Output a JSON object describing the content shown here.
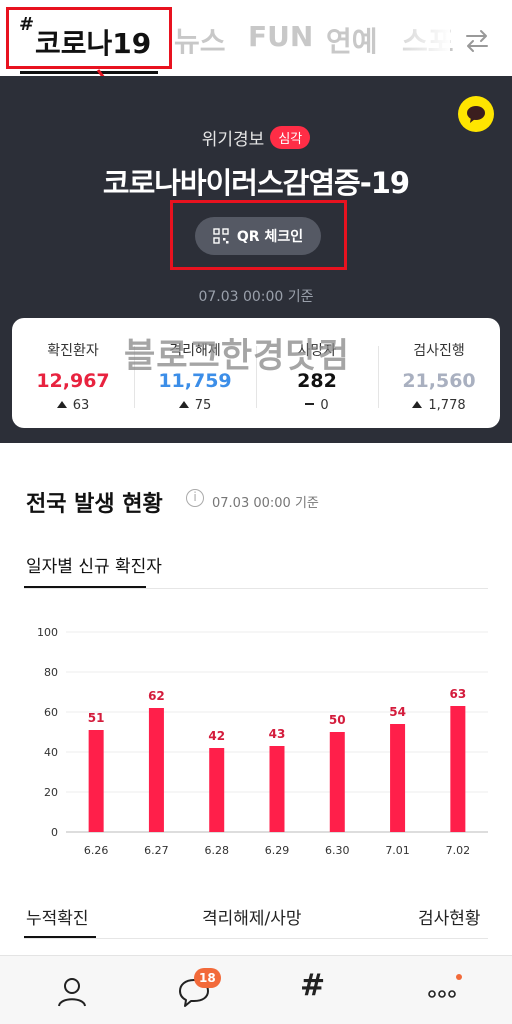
{
  "tabs": {
    "active": {
      "hash": "#",
      "label": "코로나19"
    },
    "items": [
      "뉴스",
      "FUN",
      "연예",
      "스포"
    ]
  },
  "hero": {
    "warning_label": "위기경보",
    "warning_level": "심각",
    "title": "코로나바이러스감염증-19",
    "qr_label": "QR 체크인",
    "date": "07.03 00:00 기준"
  },
  "stats": [
    {
      "label": "확진환자",
      "value": "12,967",
      "delta": "63",
      "color": "#e8233f",
      "trend": "up"
    },
    {
      "label": "격리해제",
      "value": "11,759",
      "delta": "75",
      "color": "#3c8ee8",
      "trend": "up"
    },
    {
      "label": "사망자",
      "value": "282",
      "delta": "0",
      "color": "#111111",
      "trend": "flat"
    },
    {
      "label": "검사진행",
      "value": "21,560",
      "delta": "1,778",
      "color": "#a9b0c0",
      "trend": "up"
    }
  ],
  "watermark": "블로그한경닷컴",
  "section": {
    "title": "전국 발생 현황",
    "date": "07.03 00:00 기준",
    "subtab": "일자별 신규 확진자"
  },
  "chart_data": {
    "type": "bar",
    "categories": [
      "6.26",
      "6.27",
      "6.28",
      "6.29",
      "6.30",
      "7.01",
      "7.02"
    ],
    "values": [
      51,
      62,
      42,
      43,
      50,
      54,
      63
    ],
    "ylim": [
      0,
      100
    ],
    "yticks": [
      0,
      20,
      40,
      60,
      80,
      100
    ],
    "bar_color": "#ff1f4a",
    "grid": true
  },
  "bottom_tabs": [
    "누적확진",
    "격리해제/사망",
    "검사현황"
  ],
  "nav": {
    "badge": "18",
    "hash": "#"
  }
}
